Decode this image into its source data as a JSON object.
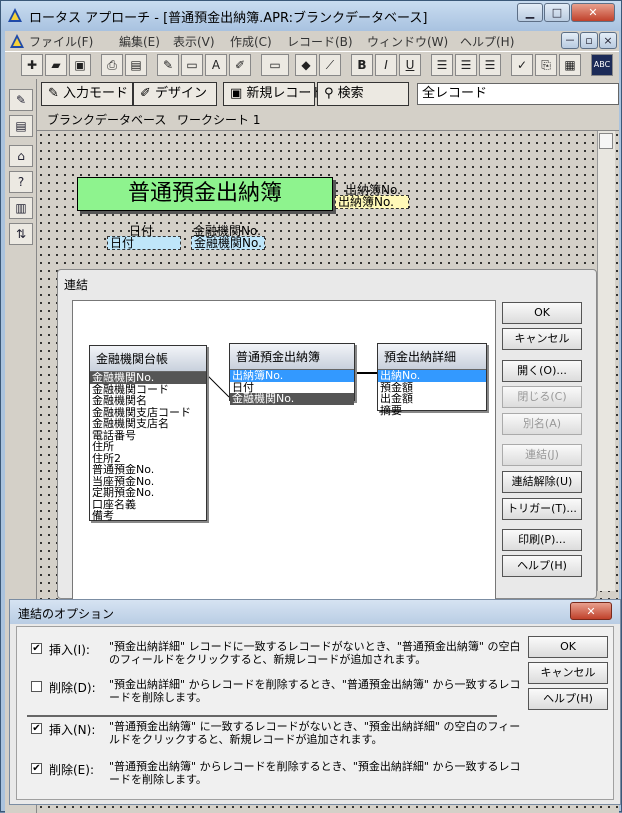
{
  "window": {
    "title": "ロータス アプローチ - [普通預金出納簿.APR:ブランクデータベース]",
    "minimize": "▁",
    "maximize": "□",
    "close": "✕"
  },
  "menu": {
    "items": [
      "ファイル(F)",
      "編集(E)",
      "表示(V)",
      "作成(C)",
      "レコード(B)",
      "ウィンドウ(W)",
      "ヘルプ(H)"
    ],
    "doc_min": "－",
    "doc_restore": "▫",
    "doc_close": "×"
  },
  "toolbar": {
    "icons": [
      "new-doc-icon",
      "open-folder-icon",
      "save-icon",
      "print-icon",
      "print-preview-icon",
      "draw-icon",
      "field-icon",
      "text-icon",
      "pencil-icon",
      "box-icon",
      "fill-color-icon",
      "line-color-icon",
      "bold-icon",
      "italic-icon",
      "underline-icon",
      "align-left-icon",
      "align-center-icon",
      "align-right-icon",
      "spell-icon",
      "paste-icon",
      "format-icon",
      "abc-icon"
    ],
    "bold": "B",
    "italic": "I",
    "underline": "U",
    "abc": "ABC"
  },
  "modes": {
    "input_mode": "入力モード",
    "design": "デザイン",
    "new_record": "新規レコード",
    "search": "検索",
    "record_filter": "全レコード"
  },
  "tabs": [
    "ブランクデータベース",
    "ワークシート 1"
  ],
  "form": {
    "title": "普通預金出納簿",
    "ledger_no_label": "出納簿No.",
    "ledger_no_field": "出納簿No.",
    "date_label": "日付",
    "date_field": "日付",
    "bank_no_label": "金融機関No.",
    "bank_no_field": "金融機関No."
  },
  "join_dialog": {
    "title": "連結",
    "tables": [
      {
        "name": "金融機関台帳",
        "fields": [
          "金融機関No.",
          "金融機関コード",
          "金融機関名",
          "金融機関支店コード",
          "金融機関支店名",
          "電話番号",
          "住所",
          "住所2",
          "普通預金No.",
          "当座預金No.",
          "定期預金No.",
          "口座名義",
          "備考"
        ]
      },
      {
        "name": "普通預金出納簿",
        "fields": [
          "出納簿No.",
          "日付",
          "金融機関No."
        ]
      },
      {
        "name": "預金出納詳細",
        "fields": [
          "出納No.",
          "預金額",
          "出金額",
          "摘要"
        ]
      }
    ],
    "buttons": {
      "ok": "OK",
      "cancel": "キャンセル",
      "open": "開く(O)...",
      "close": "閉じる(C)",
      "alias": "別名(A)",
      "join": "連結(J)",
      "unjoin": "連結解除(U)",
      "trigger": "トリガー(T)...",
      "print": "印刷(P)...",
      "help": "ヘルプ(H)"
    }
  },
  "options_dialog": {
    "title": "連結のオプション",
    "close": "✕",
    "options": [
      {
        "label": "挿入(I):",
        "checked": true,
        "desc": "\"預金出納詳細\" レコードに一致するレコードがないとき、\"普通預金出納簿\" の空白のフィールドをクリックすると、新規レコードが追加されます。"
      },
      {
        "label": "削除(D):",
        "checked": false,
        "desc": "\"預金出納詳細\" からレコードを削除するとき、\"普通預金出納簿\" から一致するレコードを削除します。"
      },
      {
        "label": "挿入(N):",
        "checked": true,
        "desc": "\"普通預金出納簿\" に一致するレコードがないとき、\"預金出納詳細\" の空白のフィールドをクリックすると、新規レコードが追加されます。"
      },
      {
        "label": "削除(E):",
        "checked": true,
        "desc": "\"普通預金出納簿\" からレコードを削除するとき、\"預金出納詳細\" から一致するレコードを削除します。"
      }
    ],
    "buttons": {
      "ok": "OK",
      "cancel": "キャンセル",
      "help": "ヘルプ(H)"
    }
  }
}
